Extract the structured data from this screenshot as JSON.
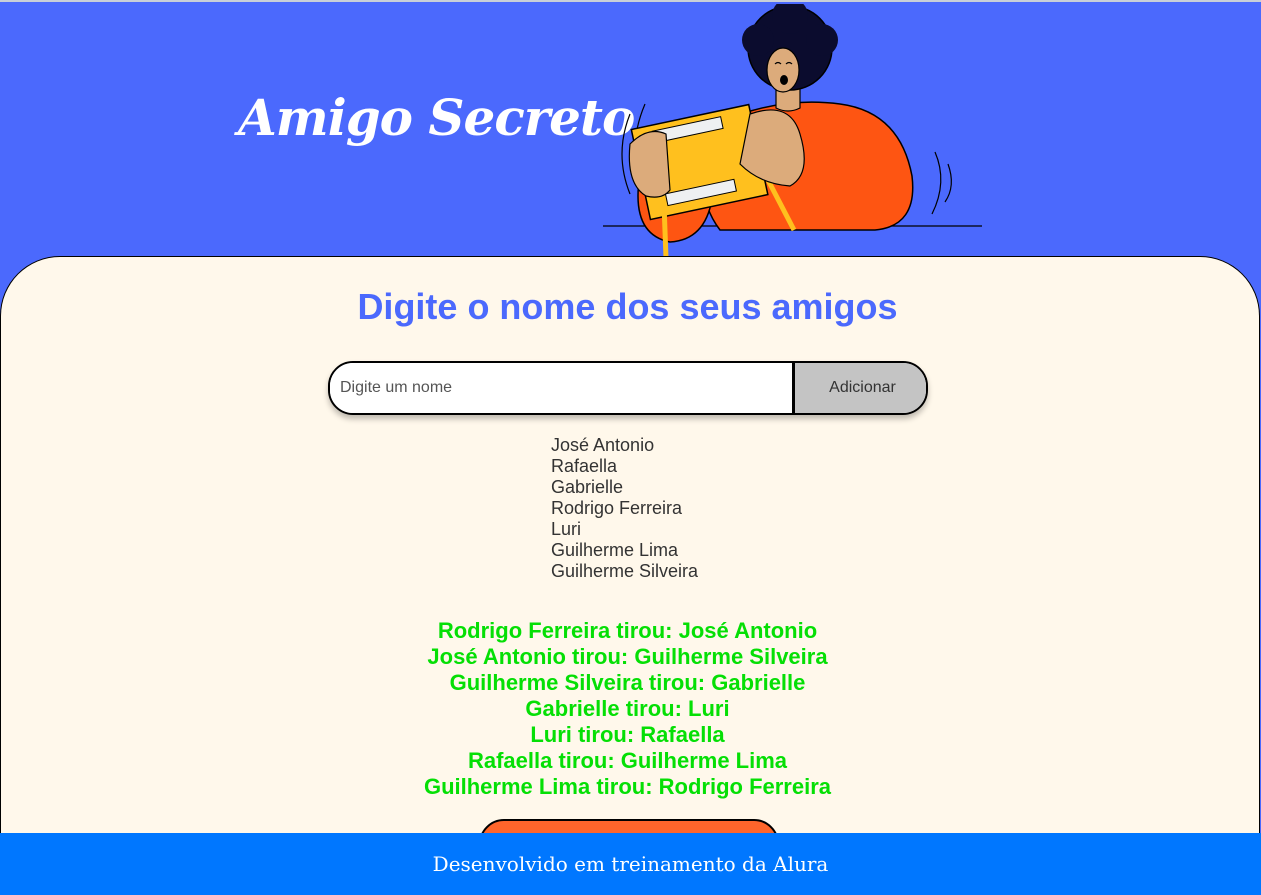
{
  "header": {
    "title": "Amigo Secreto"
  },
  "main": {
    "section_title": "Digite o nome dos seus amigos",
    "input_placeholder": "Digite um nome",
    "add_button_label": "Adicionar",
    "friends": [
      "José Antonio",
      "Rafaella",
      "Gabrielle",
      "Rodrigo Ferreira",
      "Luri",
      "Guilherme Lima",
      "Guilherme Silveira"
    ],
    "results": [
      "Rodrigo Ferreira tirou: José Antonio",
      "José Antonio tirou: Guilherme Silveira",
      "Guilherme Silveira tirou: Gabrielle",
      "Gabrielle tirou: Luri",
      "Luri tirou: Rafaella",
      "Rafaella tirou: Guilherme Lima",
      "Guilherme Lima tirou: Rodrigo Ferreira"
    ]
  },
  "footer": {
    "text": "Desenvolvido em treinamento da Alura"
  },
  "colors": {
    "header_bg": "#4b69fd",
    "card_bg": "#fff8eb",
    "title": "#4b69fd",
    "results": "#05df05",
    "draw_button": "#fe652b",
    "footer_bg": "#0077ff"
  }
}
